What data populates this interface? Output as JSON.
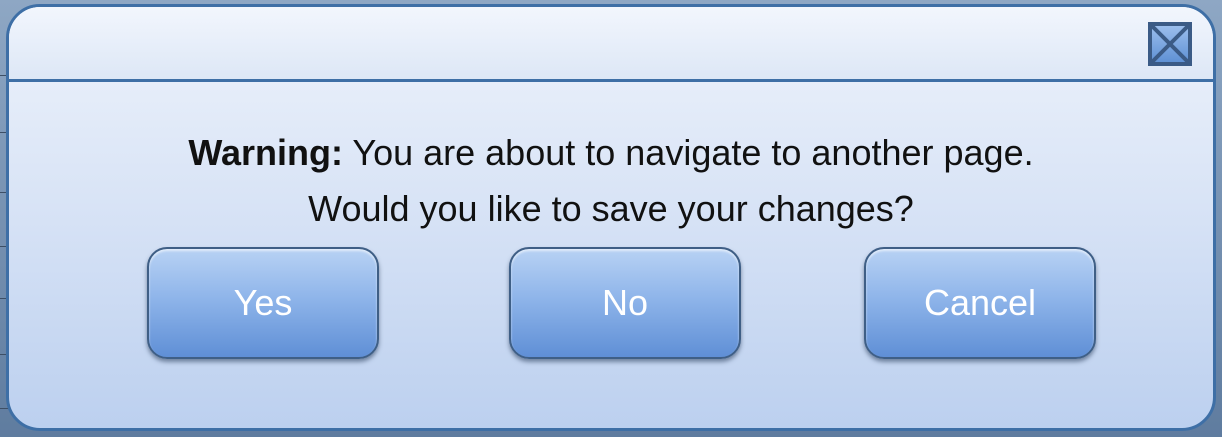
{
  "dialog": {
    "close_icon": "close-x-icon",
    "message": {
      "prefix": "Warning:",
      "line1": "You are about to navigate to another page.",
      "line2": "Would you like to save your changes?"
    },
    "buttons": {
      "yes": "Yes",
      "no": "No",
      "cancel": "Cancel"
    }
  },
  "colors": {
    "frame": "#3e6fa6",
    "button_top": "#b8d2f4",
    "button_bottom": "#5f8fd6",
    "button_text": "#ffffff"
  }
}
